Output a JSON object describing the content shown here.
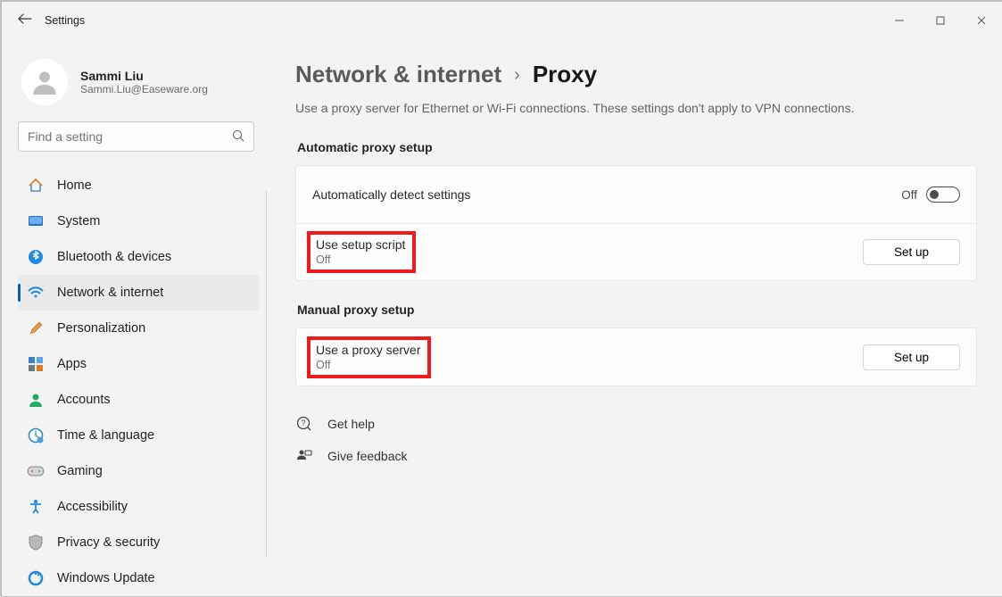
{
  "titlebar": {
    "app_title": "Settings"
  },
  "user": {
    "name": "Sammi Liu",
    "email": "Sammi.Liu@Easeware.org"
  },
  "search": {
    "placeholder": "Find a setting"
  },
  "sidebar": {
    "items": [
      {
        "label": "Home"
      },
      {
        "label": "System"
      },
      {
        "label": "Bluetooth & devices"
      },
      {
        "label": "Network & internet"
      },
      {
        "label": "Personalization"
      },
      {
        "label": "Apps"
      },
      {
        "label": "Accounts"
      },
      {
        "label": "Time & language"
      },
      {
        "label": "Gaming"
      },
      {
        "label": "Accessibility"
      },
      {
        "label": "Privacy & security"
      },
      {
        "label": "Windows Update"
      }
    ]
  },
  "breadcrumb": {
    "parent": "Network & internet",
    "current": "Proxy"
  },
  "description": "Use a proxy server for Ethernet or Wi-Fi connections. These settings don't apply to VPN connections.",
  "sections": {
    "auto": {
      "header": "Automatic proxy setup",
      "detect": {
        "title": "Automatically detect settings",
        "toggle_text": "Off"
      },
      "script": {
        "title": "Use setup script",
        "status": "Off",
        "button": "Set up"
      }
    },
    "manual": {
      "header": "Manual proxy setup",
      "server": {
        "title": "Use a proxy server",
        "status": "Off",
        "button": "Set up"
      }
    }
  },
  "footer": {
    "help": "Get help",
    "feedback": "Give feedback"
  }
}
